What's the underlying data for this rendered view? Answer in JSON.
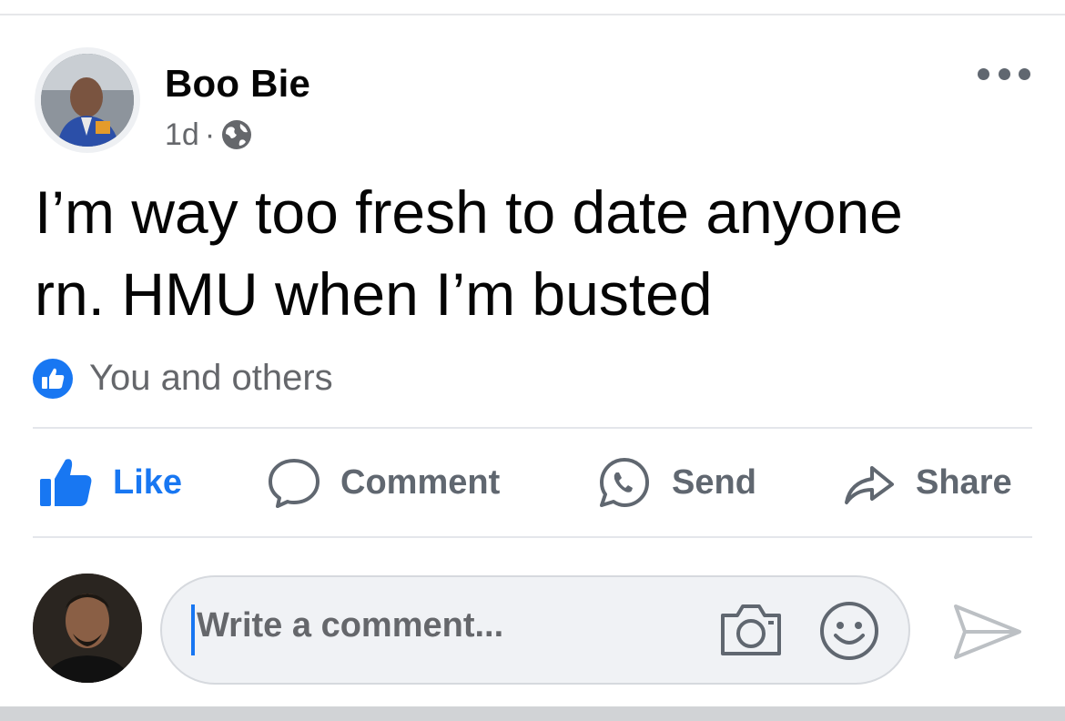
{
  "post": {
    "author": "Boo Bie",
    "time": "1d",
    "separator": "·",
    "privacy_icon": "globe-icon",
    "more_icon": "more-options-icon",
    "text_lines": [
      "I’m way too fresh to date anyone",
      "rn. HMU when I’m busted"
    ],
    "reactions_text": "You and others"
  },
  "actions": {
    "like": "Like",
    "comment": "Comment",
    "send": "Send",
    "share": "Share"
  },
  "composer": {
    "placeholder": "Write a comment..."
  },
  "colors": {
    "accent": "#1877f2",
    "secondary_text": "#65676b",
    "primary_text": "#050505",
    "input_bg": "#f0f2f5"
  }
}
